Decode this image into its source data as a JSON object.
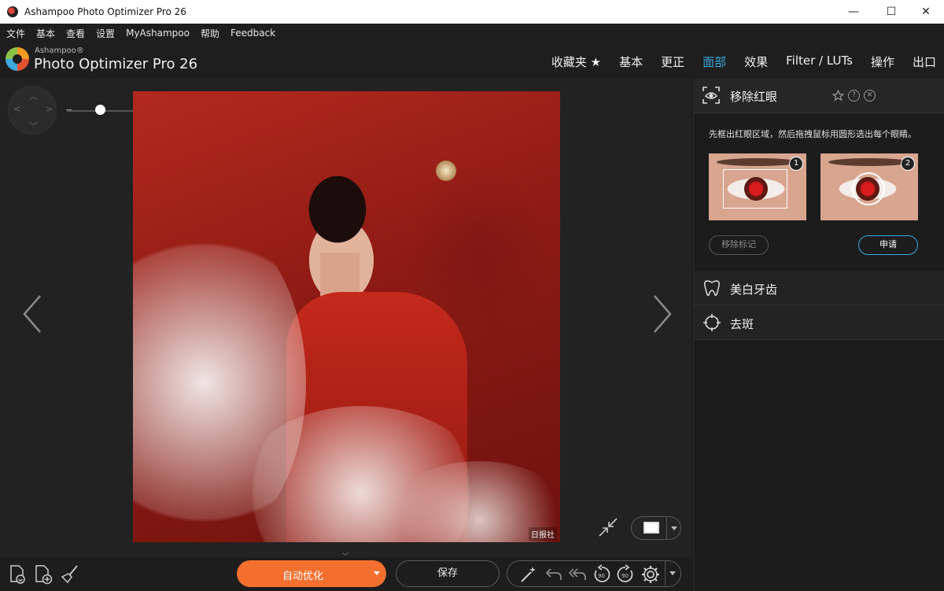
{
  "window": {
    "title": "Ashampoo Photo Optimizer Pro 26",
    "controls": {
      "minimize": "—",
      "maximize": "☐",
      "close": "✕"
    }
  },
  "menu": [
    "文件",
    "基本",
    "查看",
    "设置",
    "MyAshampoo",
    "帮助",
    "Feedback"
  ],
  "logo": {
    "brand": "Ashampoo®",
    "product": "Photo Optimizer Pro 26"
  },
  "nav": [
    "收藏夹 ★",
    "基本",
    "更正",
    "面部",
    "效果",
    "Filter / LUTs",
    "操作",
    "出口"
  ],
  "nav_active": "面部",
  "photo": {
    "watermark": "日报社"
  },
  "panel": {
    "redeye": {
      "title": "移除红眼",
      "instructions": "先框出红眼区域，然后拖拽鼠标用圆形选出每个眼睛。",
      "step1": "1",
      "step2": "2",
      "remove_marks": "移除标记",
      "apply": "申请"
    },
    "sections": [
      {
        "label": "美白牙齿",
        "icon": "tooth-icon"
      },
      {
        "label": "去斑",
        "icon": "crosshair-icon"
      }
    ]
  },
  "bottom": {
    "auto_optimize": "自动优化",
    "save": "保存"
  },
  "colors": {
    "accent": "#39a8e0",
    "orange": "#f36f2e"
  }
}
